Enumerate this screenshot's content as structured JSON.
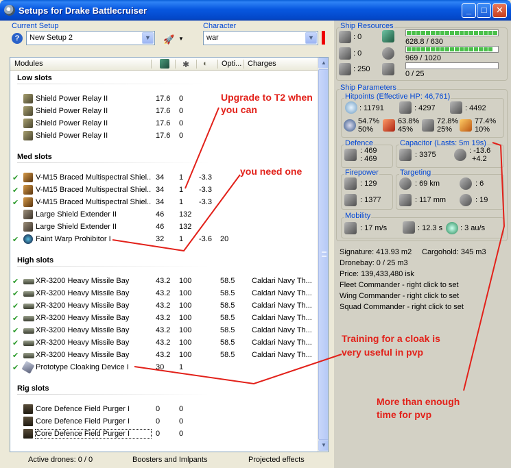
{
  "window": {
    "title": "Setups for Drake Battlecruiser",
    "min": "_",
    "max": "□",
    "close": "✕"
  },
  "current_setup": {
    "label": "Current Setup",
    "value": "New Setup 2"
  },
  "character": {
    "label": "Character",
    "value": "war"
  },
  "columns": {
    "modules": "Modules",
    "optimal": "Opti...",
    "charges": "Charges"
  },
  "sections": {
    "low": "Low slots",
    "med": "Med slots",
    "high": "High slots",
    "rig": "Rig slots"
  },
  "low_slots": [
    {
      "name": "Shield Power Relay II",
      "c1": "17.6",
      "c2": "0",
      "c3": "",
      "c4": "",
      "c5": ""
    },
    {
      "name": "Shield Power Relay II",
      "c1": "17.6",
      "c2": "0",
      "c3": "",
      "c4": "",
      "c5": ""
    },
    {
      "name": "Shield Power Relay II",
      "c1": "17.6",
      "c2": "0",
      "c3": "",
      "c4": "",
      "c5": ""
    },
    {
      "name": "Shield Power Relay II",
      "c1": "17.6",
      "c2": "0",
      "c3": "",
      "c4": "",
      "c5": ""
    }
  ],
  "med_slots": [
    {
      "name": "V-M15 Braced Multispectral Shiel...",
      "c1": "34",
      "c2": "1",
      "c3": "-3.3",
      "c4": "",
      "c5": ""
    },
    {
      "name": "V-M15 Braced Multispectral Shiel...",
      "c1": "34",
      "c2": "1",
      "c3": "-3.3",
      "c4": "",
      "c5": ""
    },
    {
      "name": "V-M15 Braced Multispectral Shiel...",
      "c1": "34",
      "c2": "1",
      "c3": "-3.3",
      "c4": "",
      "c5": ""
    },
    {
      "name": "Large Shield Extender II",
      "c1": "46",
      "c2": "132",
      "c3": "",
      "c4": "",
      "c5": ""
    },
    {
      "name": "Large Shield Extender II",
      "c1": "46",
      "c2": "132",
      "c3": "",
      "c4": "",
      "c5": ""
    },
    {
      "name": "Faint Warp Prohibitor I",
      "c1": "32",
      "c2": "1",
      "c3": "-3.6",
      "c4": "20",
      "c5": ""
    }
  ],
  "high_slots": [
    {
      "name": "XR-3200 Heavy Missile Bay",
      "c1": "43.2",
      "c2": "100",
      "c3": "",
      "c4": "58.5",
      "c5": "Caldari Navy Th..."
    },
    {
      "name": "XR-3200 Heavy Missile Bay",
      "c1": "43.2",
      "c2": "100",
      "c3": "",
      "c4": "58.5",
      "c5": "Caldari Navy Th..."
    },
    {
      "name": "XR-3200 Heavy Missile Bay",
      "c1": "43.2",
      "c2": "100",
      "c3": "",
      "c4": "58.5",
      "c5": "Caldari Navy Th..."
    },
    {
      "name": "XR-3200 Heavy Missile Bay",
      "c1": "43.2",
      "c2": "100",
      "c3": "",
      "c4": "58.5",
      "c5": "Caldari Navy Th..."
    },
    {
      "name": "XR-3200 Heavy Missile Bay",
      "c1": "43.2",
      "c2": "100",
      "c3": "",
      "c4": "58.5",
      "c5": "Caldari Navy Th..."
    },
    {
      "name": "XR-3200 Heavy Missile Bay",
      "c1": "43.2",
      "c2": "100",
      "c3": "",
      "c4": "58.5",
      "c5": "Caldari Navy Th..."
    },
    {
      "name": "XR-3200 Heavy Missile Bay",
      "c1": "43.2",
      "c2": "100",
      "c3": "",
      "c4": "58.5",
      "c5": "Caldari Navy Th..."
    },
    {
      "name": "Prototype Cloaking Device I",
      "c1": "30",
      "c2": "1",
      "c3": "",
      "c4": "",
      "c5": ""
    }
  ],
  "rig_slots": [
    {
      "name": "Core Defence Field Purger I",
      "c1": "0",
      "c2": "0",
      "c3": "",
      "c4": "",
      "c5": ""
    },
    {
      "name": "Core Defence Field Purger I",
      "c1": "0",
      "c2": "0",
      "c3": "",
      "c4": "",
      "c5": ""
    },
    {
      "name": "Core Defence Field Purger I",
      "c1": "0",
      "c2": "0",
      "c3": "",
      "c4": "",
      "c5": ""
    }
  ],
  "status": {
    "drones": "Active drones: 0 / 0",
    "boosters": "Boosters and Imlpants",
    "projected": "Projected effects"
  },
  "resources": {
    "label": "Ship Resources",
    "turrets": ": 0",
    "launchers": ": 0",
    "drone_bw": ": 250",
    "cpu": "628.8 / 630",
    "powergrid": "969 / 1020",
    "drone_bay_vol": "0 / 25",
    "cpu_fill": 0.998,
    "pg_fill": 0.95,
    "drone_fill": 0.0
  },
  "parameters": {
    "label": "Ship Parameters",
    "hitpoints_label": "Hitpoints (Effective HP: 46,761)",
    "shield_hp": ": 11791",
    "armor_hp": ": 4297",
    "structure_hp": ": 4492",
    "res": [
      {
        "top": "54.7%",
        "bottom": "50%"
      },
      {
        "top": "63.8%",
        "bottom": "45%"
      },
      {
        "top": "72.8%",
        "bottom": "25%"
      },
      {
        "top": "77.4%",
        "bottom": "10%"
      }
    ],
    "defence_label": "Defence",
    "defence_1": ": 469",
    "defence_2": ": 469",
    "capacitor_label": "Capacitor (Lasts: 5m 19s)",
    "cap_amount": ": 3375",
    "cap_delta_1": ": -13.6",
    "cap_delta_2": "+4.2",
    "firepower_label": "Firepower",
    "fire_1": ": 129",
    "fire_2": ": 1377",
    "targeting_label": "Targeting",
    "target_range": ": 69 km",
    "max_targets": ": 6",
    "scan_res": ": 117 mm",
    "sensor": ": 19",
    "mobility_label": "Mobility",
    "speed": ": 17 m/s",
    "align": ": 12.3 s",
    "warp": ": 3 au/s",
    "signature": "Signature: 413.93 m2",
    "cargohold": "Cargohold: 345 m3",
    "dronebay": "Dronebay: 0 / 25 m3",
    "price": "Price: 139,433,480 isk",
    "fleet_cmd": "Fleet Commander - right click to set",
    "wing_cmd": "Wing Commander - right click to set",
    "squad_cmd": "Squad Commander - right click to set"
  },
  "annotations": {
    "a1_line1": "Upgrade to T2 when",
    "a1_line2": "you can",
    "a2": "you need one",
    "a3_line1": "Training for a cloak is",
    "a3_line2": "very useful in pvp",
    "a4_line1": "More than enough",
    "a4_line2": "time for pvp"
  }
}
